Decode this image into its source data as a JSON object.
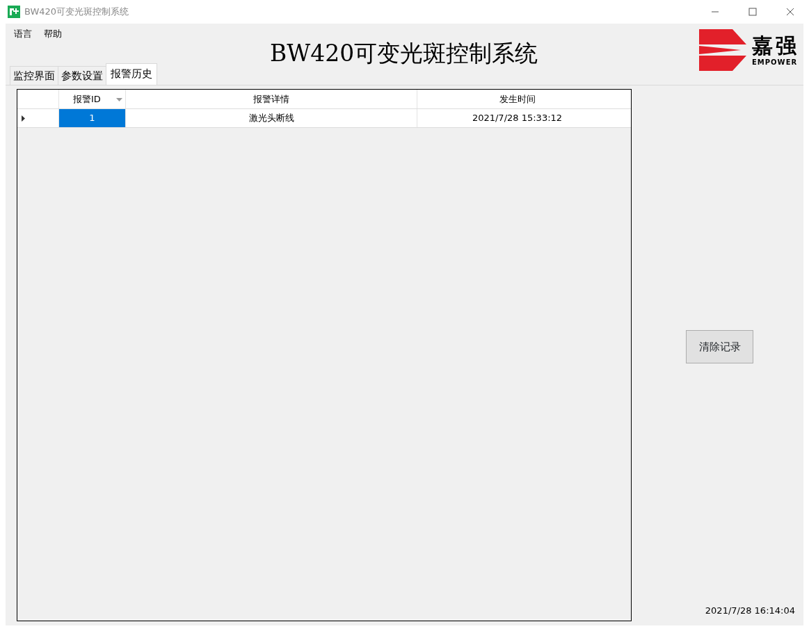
{
  "window": {
    "title": "BW420可变光斑控制系统"
  },
  "menu": [
    "语言",
    "帮助"
  ],
  "header": {
    "title": "BW420可变光斑控制系统",
    "logo_cn": "嘉强",
    "logo_en": "EMPOWER"
  },
  "tabs": [
    {
      "label": "监控界面",
      "selected": false
    },
    {
      "label": "参数设置",
      "selected": false
    },
    {
      "label": "报警历史",
      "selected": true
    }
  ],
  "table": {
    "columns": [
      {
        "label": "报警ID",
        "sorted": true
      },
      {
        "label": "报警详情",
        "sorted": false
      },
      {
        "label": "发生时间",
        "sorted": false
      }
    ],
    "rows": [
      {
        "cells": [
          "1",
          "激光头断线",
          "2021/7/28 15:33:12"
        ],
        "selected": true
      }
    ]
  },
  "clear_button": "清除记录",
  "status_time": "2021/7/28 16:14:04"
}
